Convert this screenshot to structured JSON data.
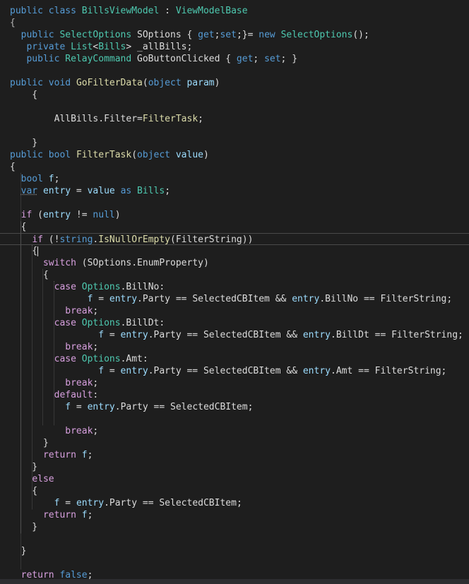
{
  "editor": {
    "language": "C#",
    "colors": {
      "background": "#1e1e1e",
      "keyword": "#569cd6",
      "control_keyword": "#d8a0df",
      "type": "#4ec9b0",
      "method": "#dcdcaa",
      "parameter": "#9cdcfe",
      "plain": "#dcdcdc"
    },
    "caret_line": 19,
    "lines": [
      [
        [
          "public",
          "kw"
        ],
        [
          " "
        ],
        [
          "class",
          "kw"
        ],
        [
          " "
        ],
        [
          "BillsViewModel",
          "typ"
        ],
        [
          " : "
        ],
        [
          "ViewModelBase",
          "typ"
        ]
      ],
      [
        [
          "{",
          "pun"
        ]
      ],
      [
        [
          "  "
        ],
        [
          "public",
          "kw"
        ],
        [
          " "
        ],
        [
          "SelectOptions",
          "typ"
        ],
        [
          " "
        ],
        [
          "SOptions",
          "prp"
        ],
        [
          " { "
        ],
        [
          "get",
          "kw"
        ],
        [
          ";"
        ],
        [
          "set",
          "kw"
        ],
        [
          ";}= "
        ],
        [
          "new",
          "kw"
        ],
        [
          " "
        ],
        [
          "SelectOptions",
          "typ"
        ],
        [
          "();"
        ]
      ],
      [
        [
          "   "
        ],
        [
          "private",
          "kw"
        ],
        [
          " "
        ],
        [
          "List",
          "typ"
        ],
        [
          "<"
        ],
        [
          "Bills",
          "typ"
        ],
        [
          "> "
        ],
        [
          "_allBills",
          "fld"
        ],
        [
          ";"
        ]
      ],
      [
        [
          "   "
        ],
        [
          "public",
          "kw"
        ],
        [
          " "
        ],
        [
          "RelayCommand",
          "typ"
        ],
        [
          " "
        ],
        [
          "GoButtonClicked",
          "prp"
        ],
        [
          " { "
        ],
        [
          "get",
          "kw"
        ],
        [
          "; "
        ],
        [
          "set",
          "kw"
        ],
        [
          "; }"
        ]
      ],
      [],
      [
        [
          "public",
          "kw"
        ],
        [
          " "
        ],
        [
          "void",
          "kw"
        ],
        [
          " "
        ],
        [
          "GoFilterData",
          "mth"
        ],
        [
          "("
        ],
        [
          "object",
          "kw"
        ],
        [
          " "
        ],
        [
          "param",
          "prm"
        ],
        [
          ")"
        ]
      ],
      [
        [
          "    {"
        ]
      ],
      [],
      [
        [
          "        "
        ],
        [
          "AllBills",
          "prp"
        ],
        [
          "."
        ],
        [
          "Filter",
          "prp"
        ],
        [
          "="
        ],
        [
          "FilterTask",
          "mth"
        ],
        [
          ";"
        ]
      ],
      [],
      [
        [
          "    }"
        ]
      ],
      [
        [
          "public",
          "kw"
        ],
        [
          " "
        ],
        [
          "bool",
          "kw"
        ],
        [
          " "
        ],
        [
          "FilterTask",
          "mth"
        ],
        [
          "("
        ],
        [
          "object",
          "kw"
        ],
        [
          " "
        ],
        [
          "value",
          "prm"
        ],
        [
          ")"
        ]
      ],
      [
        [
          "{"
        ]
      ],
      [
        [
          "  "
        ],
        [
          "bool",
          "kw"
        ],
        [
          " "
        ],
        [
          "f",
          "loc"
        ],
        [
          ";"
        ]
      ],
      [
        [
          "  "
        ],
        [
          "var",
          "kw squig"
        ],
        [
          " "
        ],
        [
          "entry",
          "loc"
        ],
        [
          " = "
        ],
        [
          "value",
          "prm"
        ],
        [
          " "
        ],
        [
          "as",
          "kw"
        ],
        [
          " "
        ],
        [
          "Bills",
          "typ"
        ],
        [
          ";"
        ]
      ],
      [],
      [
        [
          "  "
        ],
        [
          "if",
          "ctl"
        ],
        [
          " ("
        ],
        [
          "entry",
          "loc"
        ],
        [
          " != "
        ],
        [
          "null",
          "kw"
        ],
        [
          ")"
        ]
      ],
      [
        [
          "  {"
        ]
      ],
      [
        [
          "    "
        ],
        [
          "if",
          "ctl"
        ],
        [
          " (!"
        ],
        [
          "string",
          "kw"
        ],
        [
          "."
        ],
        [
          "IsNullOrEmpty",
          "mth"
        ],
        [
          "("
        ],
        [
          "FilterString",
          "prp"
        ],
        [
          "))"
        ]
      ],
      [
        [
          "    {"
        ],
        [
          "",
          "caret"
        ]
      ],
      [
        [
          "      "
        ],
        [
          "switch",
          "ctl"
        ],
        [
          " ("
        ],
        [
          "SOptions",
          "prp"
        ],
        [
          "."
        ],
        [
          "EnumProperty",
          "prp"
        ],
        [
          ")"
        ]
      ],
      [
        [
          "      {"
        ]
      ],
      [
        [
          "        "
        ],
        [
          "case",
          "ctl"
        ],
        [
          " "
        ],
        [
          "Options",
          "typ"
        ],
        [
          "."
        ],
        [
          "BillNo",
          "prp"
        ],
        [
          ":"
        ]
      ],
      [
        [
          "              "
        ],
        [
          "f",
          "loc"
        ],
        [
          " = "
        ],
        [
          "entry",
          "loc"
        ],
        [
          "."
        ],
        [
          "Party",
          "prp"
        ],
        [
          " == "
        ],
        [
          "SelectedCBItem",
          "prp"
        ],
        [
          " && "
        ],
        [
          "entry",
          "loc"
        ],
        [
          "."
        ],
        [
          "BillNo",
          "prp"
        ],
        [
          " == "
        ],
        [
          "FilterString",
          "prp"
        ],
        [
          ";"
        ]
      ],
      [
        [
          "          "
        ],
        [
          "break",
          "ctl"
        ],
        [
          ";"
        ]
      ],
      [
        [
          "        "
        ],
        [
          "case",
          "ctl"
        ],
        [
          " "
        ],
        [
          "Options",
          "typ"
        ],
        [
          "."
        ],
        [
          "BillDt",
          "prp"
        ],
        [
          ":"
        ]
      ],
      [
        [
          "                "
        ],
        [
          "f",
          "loc"
        ],
        [
          " = "
        ],
        [
          "entry",
          "loc"
        ],
        [
          "."
        ],
        [
          "Party",
          "prp"
        ],
        [
          " == "
        ],
        [
          "SelectedCBItem",
          "prp"
        ],
        [
          " && "
        ],
        [
          "entry",
          "loc"
        ],
        [
          "."
        ],
        [
          "BillDt",
          "prp"
        ],
        [
          " == "
        ],
        [
          "FilterString",
          "prp"
        ],
        [
          ";"
        ]
      ],
      [
        [
          "          "
        ],
        [
          "break",
          "ctl"
        ],
        [
          ";"
        ]
      ],
      [
        [
          "        "
        ],
        [
          "case",
          "ctl"
        ],
        [
          " "
        ],
        [
          "Options",
          "typ"
        ],
        [
          "."
        ],
        [
          "Amt",
          "prp"
        ],
        [
          ":"
        ]
      ],
      [
        [
          "                "
        ],
        [
          "f",
          "loc"
        ],
        [
          " = "
        ],
        [
          "entry",
          "loc"
        ],
        [
          "."
        ],
        [
          "Party",
          "prp"
        ],
        [
          " == "
        ],
        [
          "SelectedCBItem",
          "prp"
        ],
        [
          " && "
        ],
        [
          "entry",
          "loc"
        ],
        [
          "."
        ],
        [
          "Amt",
          "prp"
        ],
        [
          " == "
        ],
        [
          "FilterString",
          "prp"
        ],
        [
          ";"
        ]
      ],
      [
        [
          "          "
        ],
        [
          "break",
          "ctl"
        ],
        [
          ";"
        ]
      ],
      [
        [
          "        "
        ],
        [
          "default",
          "ctl"
        ],
        [
          ":"
        ]
      ],
      [
        [
          "          "
        ],
        [
          "f",
          "loc"
        ],
        [
          " = "
        ],
        [
          "entry",
          "loc"
        ],
        [
          "."
        ],
        [
          "Party",
          "prp"
        ],
        [
          " == "
        ],
        [
          "SelectedCBItem",
          "prp"
        ],
        [
          ";"
        ]
      ],
      [],
      [
        [
          "          "
        ],
        [
          "break",
          "ctl"
        ],
        [
          ";"
        ]
      ],
      [
        [
          "      }"
        ]
      ],
      [
        [
          "      "
        ],
        [
          "return",
          "ctl"
        ],
        [
          " "
        ],
        [
          "f",
          "loc"
        ],
        [
          ";"
        ]
      ],
      [
        [
          "    }"
        ]
      ],
      [
        [
          "    "
        ],
        [
          "else",
          "ctl"
        ]
      ],
      [
        [
          "    {"
        ]
      ],
      [
        [
          "        "
        ],
        [
          "f",
          "loc"
        ],
        [
          " = "
        ],
        [
          "entry",
          "loc"
        ],
        [
          "."
        ],
        [
          "Party",
          "prp"
        ],
        [
          " == "
        ],
        [
          "SelectedCBItem",
          "prp"
        ],
        [
          ";"
        ]
      ],
      [
        [
          "      "
        ],
        [
          "return",
          "ctl"
        ],
        [
          " "
        ],
        [
          "f",
          "loc"
        ],
        [
          ";"
        ]
      ],
      [
        [
          "    }"
        ]
      ],
      [],
      [
        [
          "  }"
        ]
      ],
      [],
      [
        [
          "  "
        ],
        [
          "return",
          "ctl"
        ],
        [
          " "
        ],
        [
          "false",
          "kw"
        ],
        [
          ";"
        ]
      ],
      [
        [
          "}"
        ]
      ]
    ]
  }
}
